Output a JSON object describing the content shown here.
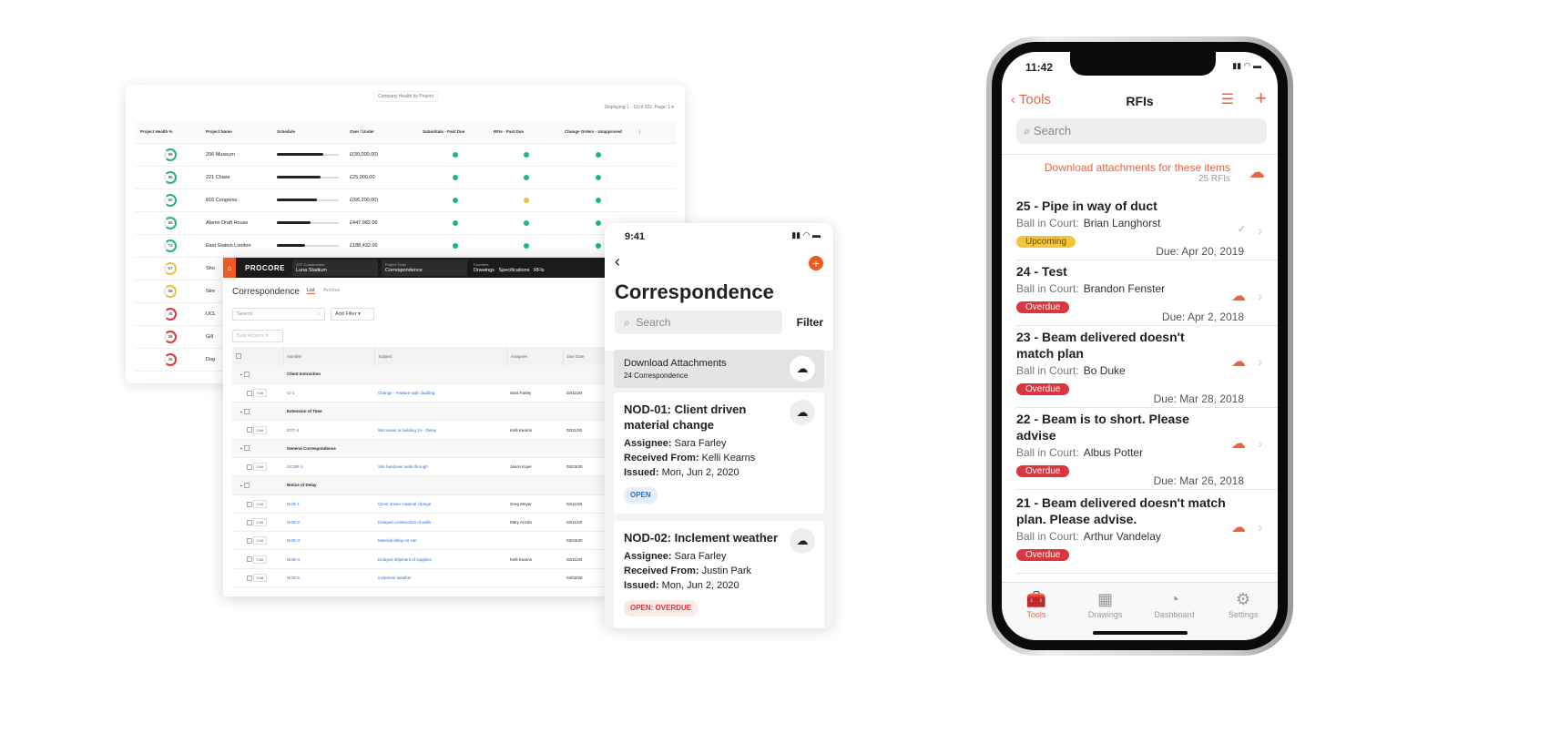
{
  "dashboard": {
    "title": "Company Health by Project",
    "displaying": "Displaying 1 - 10 of 322",
    "page_label": "Page:",
    "page": "1",
    "columns": [
      "Project Health %",
      "Project Name",
      "Schedule",
      "Over / Under",
      "Submittals - Past Due",
      "RFIs - Past Due",
      "Change Orders - Unapproved"
    ],
    "rows": [
      {
        "health": 98,
        "name": "206 Museum",
        "schedule": 0.75,
        "over_under": "£(30,000.00)",
        "s": "green",
        "r": "green",
        "c": "green"
      },
      {
        "health": 95,
        "name": "221 Chase",
        "schedule": 0.7,
        "over_under": "£25,000.00",
        "s": "green",
        "r": "green",
        "c": "green"
      },
      {
        "health": 90,
        "name": "816 Congress",
        "schedule": 0.65,
        "over_under": "£(66,200.00)",
        "s": "green",
        "r": "yellow",
        "c": "green"
      },
      {
        "health": 85,
        "name": "Alamo Draft House",
        "schedule": 0.55,
        "over_under": "£447,982.00",
        "s": "green",
        "r": "green",
        "c": "green"
      },
      {
        "health": 72,
        "name": "East Station London",
        "schedule": 0.45,
        "over_under": "£188,432.00",
        "s": "green",
        "r": "green",
        "c": "green"
      },
      {
        "health": 67,
        "name": "Sho",
        "schedule": 0,
        "over_under": "",
        "s": "",
        "r": "",
        "c": ""
      },
      {
        "health": 58,
        "name": "Stre",
        "schedule": 0,
        "over_under": "",
        "s": "",
        "r": "",
        "c": ""
      },
      {
        "health": 45,
        "name": "UCL",
        "schedule": 0,
        "over_under": "",
        "s": "",
        "r": "",
        "c": ""
      },
      {
        "health": 38,
        "name": "Gill",
        "schedule": 0,
        "over_under": "",
        "s": "",
        "r": "",
        "c": ""
      },
      {
        "health": 26,
        "name": "Dog",
        "schedule": 0,
        "over_under": "",
        "s": "",
        "r": "",
        "c": ""
      }
    ]
  },
  "desktop": {
    "logo": "PROCORE",
    "company_label": "STF Construction",
    "company": "Luna Stadium",
    "tool_label": "Project Tools",
    "tool": "Correspondence",
    "fav_label": "Favorites",
    "favorites": [
      "Drawings",
      "Specifications",
      "RFIs"
    ],
    "title": "Correspondence",
    "tabs": [
      "List",
      "Archive"
    ],
    "search_placeholder": "Search",
    "add_filter": "Add Filter",
    "bulk_actions": "Bulk Actions",
    "columns": [
      "Number",
      "Subject",
      "Assignee",
      "Due Date"
    ],
    "edit": "Edit",
    "groups": [
      {
        "name": "Client Instruction",
        "items": [
          [
            "CI-1",
            "Change - Feature wall cladding",
            "Sara Farley",
            "02/11/20"
          ]
        ]
      },
      {
        "name": "Extension of Time",
        "items": [
          [
            "EOT-4",
            "Wet areas in building 2A - Delay",
            "Kelli Kearns",
            "02/11/20"
          ]
        ]
      },
      {
        "name": "General Correspondence",
        "items": [
          [
            "GCOR-1",
            "Site handover walk-through",
            "Jason Kaye",
            "03/23/20"
          ]
        ]
      },
      {
        "name": "Notice of Delay",
        "items": [
          [
            "NOD-1",
            "Client driven material change",
            "Greg Meyer",
            "02/11/20"
          ],
          [
            "NOD-2",
            "Delayed construction of walls",
            "Mary Arzola",
            "02/11/20"
          ],
          [
            "NOD-3",
            "Material delay on site",
            "",
            "03/23/20"
          ],
          [
            "NOD-4",
            "Delayed shipment of supplies",
            "Kelli Kearns",
            "02/11/20"
          ],
          [
            "NOD-5",
            "Inclement weather",
            "",
            "04/02/20"
          ]
        ]
      }
    ]
  },
  "mobile": {
    "time": "9:41",
    "title": "Correspondence",
    "search_placeholder": "Search",
    "filter": "Filter",
    "download_title": "Download Attachments",
    "download_count": "24 Correspondence",
    "cards": [
      {
        "title": "NOD-01: Client driven material change",
        "assignee_label": "Assignee:",
        "assignee": "Sara Farley",
        "from_label": "Received From:",
        "from": "Kelli Kearns",
        "issued_label": "Issued:",
        "issued": "Mon, Jun 2, 2020",
        "status": "OPEN"
      },
      {
        "title": "NOD-02: Inclement weather",
        "assignee_label": "Assignee:",
        "assignee": "Sara Farley",
        "from_label": "Received From:",
        "from": "Justin Park",
        "issued_label": "Issued:",
        "issued": "Mon, Jun 2, 2020",
        "status": "OPEN: OVERDUE"
      }
    ]
  },
  "phone": {
    "time": "11:42",
    "back": "Tools",
    "title": "RFIs",
    "search_placeholder": "Search",
    "download_text": "Download attachments for these items",
    "download_count": "25 RFIs",
    "bic_label": "Ball in Court:",
    "rfis": [
      {
        "title": "25 - Pipe in way of duct",
        "bic": "Brian Langhorst",
        "status": "Upcoming",
        "due": "Due: Apr 20, 2019"
      },
      {
        "title": "24 - Test",
        "bic": "Brandon Fenster",
        "status": "Overdue",
        "due": "Due: Apr 2, 2018"
      },
      {
        "title": "23 - Beam delivered doesn't match plan",
        "bic": "Bo Duke",
        "status": "Overdue",
        "due": "Due: Mar 28, 2018"
      },
      {
        "title": "22 - Beam is to short. Please advise",
        "bic": "Albus Potter",
        "status": "Overdue",
        "due": "Due: Mar 26, 2018"
      },
      {
        "title": "21 - Beam delivered doesn't match plan. Please advise.",
        "bic": "Arthur Vandelay",
        "status": "Overdue",
        "due": ""
      }
    ],
    "tabs": [
      {
        "label": "Tools",
        "icon": "toolbox-icon"
      },
      {
        "label": "Drawings",
        "icon": "drawings-icon"
      },
      {
        "label": "Dashboard",
        "icon": "gauge-icon"
      },
      {
        "label": "Settings",
        "icon": "gear-icon"
      }
    ]
  },
  "colors": {
    "accent": "#f05a22",
    "green": "#1fb38a",
    "yellow": "#e8c23a",
    "red": "#d9363e",
    "link": "#2a6fd6"
  }
}
